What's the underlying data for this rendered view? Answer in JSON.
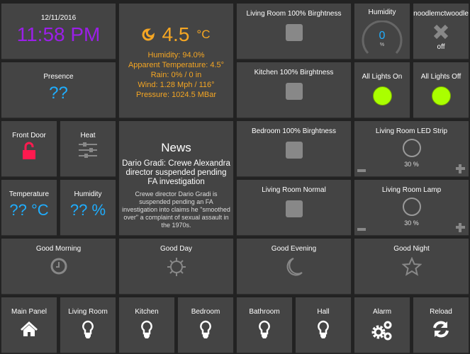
{
  "clock": {
    "date": "12/11/2016",
    "time": "11:58 PM"
  },
  "weather": {
    "temp": "4.5",
    "unit": "°C",
    "humidity": "Humidity: 94.0%",
    "apparent": "Apparent Temperature: 4.5°",
    "rain": "Rain: 0% / 0 in",
    "wind": "Wind: 1.28 Mph / 116°",
    "pressure": "Pressure: 1024.5 MBar"
  },
  "presence": {
    "title": "Presence",
    "value": "??"
  },
  "scenes_brightness": [
    {
      "title": "Living Room 100% Birghtness"
    },
    {
      "title": "Kitchen 100% Birghtness"
    },
    {
      "title": "Bedroom 100% Birghtness"
    },
    {
      "title": "Living Room Normal"
    }
  ],
  "humidity_gauge": {
    "title": "Humidity",
    "value": "0",
    "unit": "%"
  },
  "device": {
    "title": "noodlemctwoodle",
    "state": "off"
  },
  "all_on": {
    "title": "All Lights On"
  },
  "all_off": {
    "title": "All Lights Off"
  },
  "front_door": {
    "title": "Front Door"
  },
  "heat": {
    "title": "Heat"
  },
  "news": {
    "title": "News",
    "headline": "Dario Gradi: Crewe Alexandra director suspended pending FA investigation",
    "body": "Crewe director Dario Gradi is suspended pending an FA investigation into claims he \"smoothed over\" a complaint of sexual assault in the 1970s."
  },
  "temperature": {
    "title": "Temperature",
    "value": "??",
    "unit": "°C"
  },
  "humidity": {
    "title": "Humidity",
    "value": "??",
    "unit": "%"
  },
  "dimmers": [
    {
      "title": "Living Room LED Strip",
      "level": "30 %"
    },
    {
      "title": "Living Room Lamp",
      "level": "30 %"
    }
  ],
  "routines": [
    {
      "title": "Good Morning"
    },
    {
      "title": "Good Day"
    },
    {
      "title": "Good Evening"
    },
    {
      "title": "Good Night"
    }
  ],
  "nav": [
    {
      "title": "Main Panel"
    },
    {
      "title": "Living Room"
    },
    {
      "title": "Kitchen"
    },
    {
      "title": "Bedroom"
    },
    {
      "title": "Bathroom"
    },
    {
      "title": "Hall"
    },
    {
      "title": "Alarm"
    },
    {
      "title": "Reload"
    }
  ],
  "colors": {
    "clock": "#9b1fe8",
    "weather": "#f5a623",
    "blue": "#1faeff",
    "lock": "#ff1a4f",
    "on": "#aaff00"
  }
}
